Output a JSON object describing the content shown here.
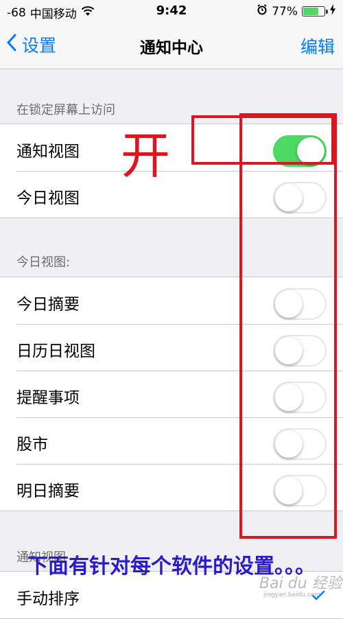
{
  "status_bar": {
    "signal": "-68",
    "carrier": "中国移动",
    "wifi_icon": "wifi-icon",
    "time": "9:42",
    "alarm_icon": "alarm-icon",
    "battery_percent": "77%",
    "battery_level": 0.77,
    "charging_icon": "bolt-icon"
  },
  "nav": {
    "back_label": "设置",
    "title": "通知中心",
    "edit_label": "编辑"
  },
  "section1": {
    "header": "在锁定屏幕上访问",
    "rows": [
      {
        "label": "通知视图",
        "on": true
      },
      {
        "label": "今日视图",
        "on": false
      }
    ]
  },
  "section2": {
    "header": "今日视图:",
    "rows": [
      {
        "label": "今日摘要",
        "on": false
      },
      {
        "label": "日历日视图",
        "on": false
      },
      {
        "label": "提醒事项",
        "on": false
      },
      {
        "label": "股市",
        "on": false
      },
      {
        "label": "明日摘要",
        "on": false
      }
    ]
  },
  "section3": {
    "header": "通知视图",
    "rows": [
      {
        "label": "手动排序",
        "checked": true
      }
    ]
  },
  "annotations": {
    "open_text": "开",
    "bottom_text": "下面有针对每个软件的设置。。。",
    "color_red": "#e0141e",
    "color_blue": "#2a1bc8"
  },
  "watermark": {
    "text": "Bai du 经验",
    "sub": "jingyan.baidu.com"
  },
  "colors": {
    "accent": "#007aff",
    "switch_on": "#4cd964",
    "background": "#efeff4"
  }
}
